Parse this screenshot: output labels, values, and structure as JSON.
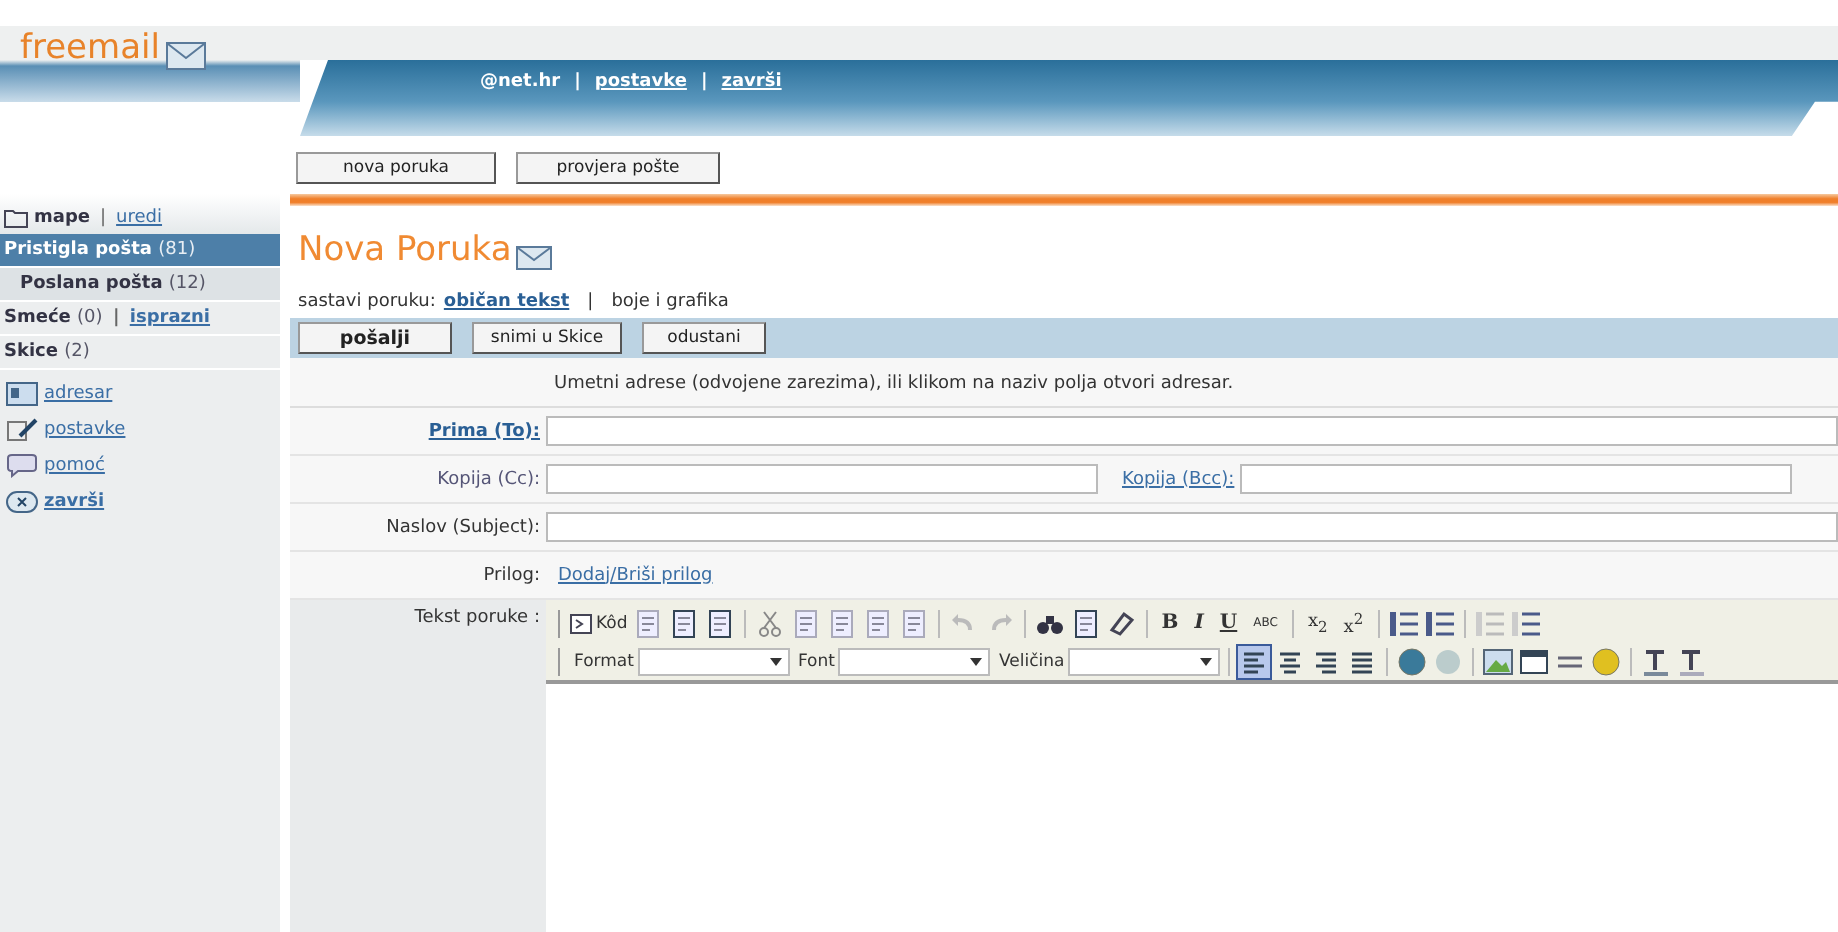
{
  "header": {
    "logo": "freemail",
    "links": [
      {
        "kind": "plain",
        "text": "@net.hr"
      },
      {
        "kind": "sep",
        "text": "|"
      },
      {
        "kind": "link",
        "text": "postavke"
      },
      {
        "kind": "sep",
        "text": "|"
      },
      {
        "kind": "link",
        "text": "završi"
      }
    ]
  },
  "top_buttons": [
    "nova poruka",
    "provjera pošte"
  ],
  "sidebar": {
    "header": [
      {
        "kind": "plain",
        "text": "mape"
      },
      {
        "kind": "sep",
        "text": "|"
      },
      {
        "kind": "link",
        "text": "uredi"
      }
    ],
    "folders": [
      {
        "kind": "folder",
        "name": "Pristigla pošta",
        "count": "(81)",
        "selected": true
      },
      {
        "kind": "subfolder",
        "name": "Poslana pošta",
        "count": "(12)",
        "selected": false
      },
      {
        "kind": "folder",
        "name": "Smeće",
        "count": "(0)",
        "separator": "|",
        "action": "isprazni",
        "selected": false
      },
      {
        "kind": "folder",
        "name": "Skice",
        "count": "(2)",
        "selected": false
      }
    ],
    "links": [
      {
        "label": "adresar",
        "bold": false
      },
      {
        "label": "postavke",
        "bold": false
      },
      {
        "label": "pomoć",
        "bold": false
      },
      {
        "label": "završi",
        "bold": true
      }
    ]
  },
  "compose": {
    "title": "Nova Poruka",
    "mode_label": "sastavi poruku:",
    "modes": [
      {
        "label": "običan tekst",
        "selected": true
      },
      {
        "label": "boje i grafika",
        "selected": false
      }
    ],
    "mode_separator": "|",
    "actions": [
      {
        "label": "pošalji",
        "primary": true
      },
      {
        "label": "snimi u Skice",
        "primary": false
      },
      {
        "label": "odustani",
        "primary": false
      }
    ],
    "hint": "Umetni adrese (odvojene zarezima), ili klikom na naziv polja otvori adresar.",
    "to_label": "Prima (To):",
    "cc_label": "Kopija (Cc):",
    "bcc_label": "Kopija (Bcc):",
    "subject_label": "Naslov (Subject):",
    "attachment_label": "Prilog:",
    "attachment_link": "Dodaj/Briši prilog",
    "body_label": "Tekst poruke :"
  },
  "editor": {
    "source_button": "Kôd",
    "format_buttons": [
      "B",
      "I",
      "U",
      "ABC",
      "x$_{2}$",
      "x$^{2}$"
    ],
    "selects": [
      "Format",
      "Font",
      "Veličina"
    ],
    "alignment_buttons": [
      {
        "selected": true
      },
      {
        "selected": false
      },
      {
        "selected": false
      },
      {
        "selected": false
      }
    ]
  }
}
